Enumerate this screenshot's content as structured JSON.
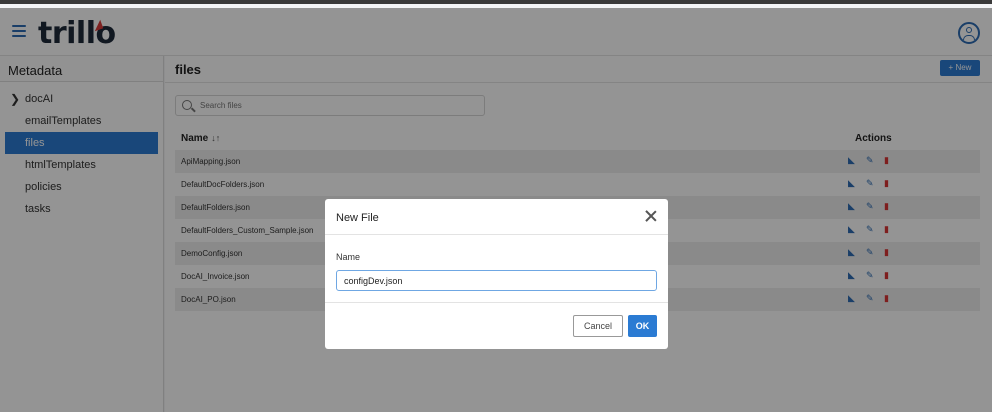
{
  "app": {
    "logo": "trillo"
  },
  "sidebar": {
    "title": "Metadata",
    "items": [
      {
        "label": "docAI",
        "expandable": true
      },
      {
        "label": "emailTemplates"
      },
      {
        "label": "files",
        "active": true
      },
      {
        "label": "htmlTemplates"
      },
      {
        "label": "policies"
      },
      {
        "label": "tasks"
      }
    ]
  },
  "main": {
    "title": "files",
    "new_label": "+ New",
    "search": {
      "placeholder": "Search files",
      "value": ""
    },
    "table": {
      "col_name": "Name",
      "sort_icon": "↓↑",
      "col_actions": "Actions",
      "rows": [
        "ApiMapping.json",
        "DefaultDocFolders.json",
        "DefaultFolders.json",
        "DefaultFolders_Custom_Sample.json",
        "DemoConfig.json",
        "DocAI_Invoice.json",
        "DocAI_PO.json"
      ],
      "action_icons": [
        "download-icon",
        "edit-icon",
        "delete-icon"
      ]
    }
  },
  "modal": {
    "title": "New File",
    "field_label": "Name",
    "field_value": "configDev.json",
    "cancel_label": "Cancel",
    "ok_label": "OK"
  },
  "colors": {
    "accent": "#2b7bd3",
    "danger": "#d93434",
    "brand_dark": "#1e2a3a"
  }
}
